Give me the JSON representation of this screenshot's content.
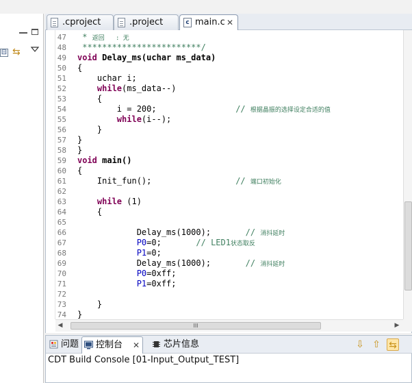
{
  "tabs": [
    ".cproject",
    ".project",
    "main.c"
  ],
  "code_lines": [
    {
      "n": "47",
      "segments": [
        {
          "t": " * ",
          "c": "com"
        },
        {
          "t": "返回   : 无",
          "c": "com small"
        }
      ]
    },
    {
      "n": "48",
      "segments": [
        {
          "t": " ************************/",
          "c": "com"
        }
      ]
    },
    {
      "n": "49",
      "segments": [
        {
          "t": "void",
          "c": "kw"
        },
        {
          "t": " Delay_ms(uchar ms_data)",
          "c": "bold"
        }
      ]
    },
    {
      "n": "50",
      "segments": [
        {
          "t": "{",
          "c": ""
        }
      ]
    },
    {
      "n": "51",
      "segments": [
        {
          "t": "    uchar i;",
          "c": ""
        }
      ]
    },
    {
      "n": "52",
      "segments": [
        {
          "t": "    ",
          "c": ""
        },
        {
          "t": "while",
          "c": "kw"
        },
        {
          "t": "(ms_data--)",
          "c": ""
        }
      ]
    },
    {
      "n": "53",
      "segments": [
        {
          "t": "    {",
          "c": ""
        }
      ]
    },
    {
      "n": "54",
      "segments": [
        {
          "t": "        i = 200;                ",
          "c": ""
        },
        {
          "t": "// ",
          "c": "com"
        },
        {
          "t": "根据晶振的选择设定合适的值",
          "c": "com small"
        }
      ]
    },
    {
      "n": "55",
      "segments": [
        {
          "t": "        ",
          "c": ""
        },
        {
          "t": "while",
          "c": "kw"
        },
        {
          "t": "(i--);",
          "c": ""
        }
      ]
    },
    {
      "n": "56",
      "segments": [
        {
          "t": "    }",
          "c": ""
        }
      ]
    },
    {
      "n": "57",
      "segments": [
        {
          "t": "}",
          "c": ""
        }
      ]
    },
    {
      "n": "58",
      "segments": [
        {
          "t": "}",
          "c": ""
        }
      ]
    },
    {
      "n": "59",
      "segments": [
        {
          "t": "void",
          "c": "kw"
        },
        {
          "t": " main()",
          "c": "bold"
        }
      ]
    },
    {
      "n": "60",
      "segments": [
        {
          "t": "{",
          "c": ""
        }
      ]
    },
    {
      "n": "61",
      "segments": [
        {
          "t": "    Init_fun();                 ",
          "c": ""
        },
        {
          "t": "// ",
          "c": "com"
        },
        {
          "t": "端口初始化",
          "c": "com small"
        }
      ]
    },
    {
      "n": "62",
      "segments": []
    },
    {
      "n": "63",
      "segments": [
        {
          "t": "    ",
          "c": ""
        },
        {
          "t": "while",
          "c": "kw"
        },
        {
          "t": " (1)",
          "c": ""
        }
      ]
    },
    {
      "n": "64",
      "segments": [
        {
          "t": "    {",
          "c": ""
        }
      ]
    },
    {
      "n": "65",
      "segments": []
    },
    {
      "n": "66",
      "segments": [
        {
          "t": "            Delay_ms(1000);       ",
          "c": ""
        },
        {
          "t": "// ",
          "c": "com"
        },
        {
          "t": "消抖延时",
          "c": "com small"
        }
      ]
    },
    {
      "n": "67",
      "segments": [
        {
          "t": "            ",
          "c": ""
        },
        {
          "t": "P0",
          "c": "reg"
        },
        {
          "t": "=0;       ",
          "c": ""
        },
        {
          "t": "// LED1",
          "c": "com"
        },
        {
          "t": "状态取反",
          "c": "com small"
        }
      ]
    },
    {
      "n": "68",
      "segments": [
        {
          "t": "            ",
          "c": ""
        },
        {
          "t": "P1",
          "c": "reg"
        },
        {
          "t": "=0;",
          "c": ""
        }
      ]
    },
    {
      "n": "69",
      "segments": [
        {
          "t": "            Delay_ms(1000);       ",
          "c": ""
        },
        {
          "t": "// ",
          "c": "com"
        },
        {
          "t": "消抖延时",
          "c": "com small"
        }
      ]
    },
    {
      "n": "70",
      "segments": [
        {
          "t": "            ",
          "c": ""
        },
        {
          "t": "P0",
          "c": "reg"
        },
        {
          "t": "=0xff;",
          "c": ""
        }
      ]
    },
    {
      "n": "71",
      "segments": [
        {
          "t": "            ",
          "c": ""
        },
        {
          "t": "P1",
          "c": "reg"
        },
        {
          "t": "=0xff;",
          "c": ""
        }
      ]
    },
    {
      "n": "72",
      "segments": []
    },
    {
      "n": "73",
      "segments": [
        {
          "t": "    }",
          "c": ""
        }
      ]
    },
    {
      "n": "74",
      "segments": [
        {
          "t": "}",
          "c": ""
        }
      ]
    }
  ],
  "hscroll_grip": "III",
  "bottom_tabs": [
    "问题",
    "控制台",
    "芯片信息"
  ],
  "console_title": "CDT Build Console [01-Input_Output_TEST]",
  "icons": {
    "tab_file": "file-icon",
    "tab_c": "c-source-file-icon",
    "close": "close-icon",
    "problems": "problems-icon",
    "console": "console-icon",
    "chip": "chip-icon",
    "down": "arrow-down-icon",
    "up": "arrow-up-icon",
    "link": "link-editor-icon"
  },
  "glyphs": {
    "close": "✕",
    "collapse": "⊟",
    "up": "⇧",
    "down": "⇩",
    "link": "⇆",
    "left": "◀",
    "right": "▶",
    "c": "c"
  }
}
